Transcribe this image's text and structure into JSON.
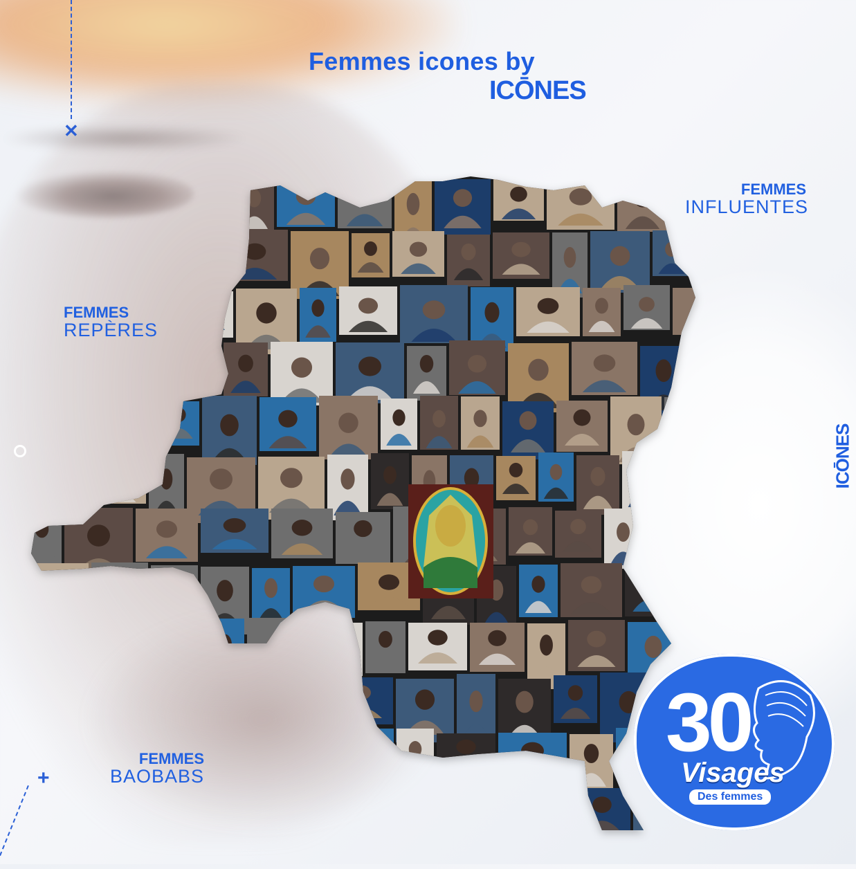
{
  "header": {
    "title": "Femmes icones by",
    "brand_logo_text": "ICŌNES"
  },
  "categories": {
    "influentes": {
      "bold": "FEMMES",
      "light": "INFLUENTES"
    },
    "reperes": {
      "bold": "FEMMES",
      "light": "REPÈRES"
    },
    "baobabs": {
      "bold": "FEMMES",
      "light": "BAOBABS"
    }
  },
  "side_logo": {
    "text": "ICŌNES"
  },
  "badge": {
    "number": "30",
    "word": "Visages",
    "subtitle": "Des femmes"
  },
  "colors": {
    "brand_blue": "#1f5ee0",
    "badge_blue": "#2a6ae3",
    "photo_dark": "#1c1c1f"
  },
  "photo_mosaic": {
    "shape": "map-of-drc",
    "tone_palette": [
      "#2d2a2a",
      "#5b4b44",
      "#8a7566",
      "#3c5a7a",
      "#b9a68f",
      "#d8d4cf",
      "#1f3d6b",
      "#6e6e6e",
      "#a7875f",
      "#2b6ea6"
    ]
  }
}
